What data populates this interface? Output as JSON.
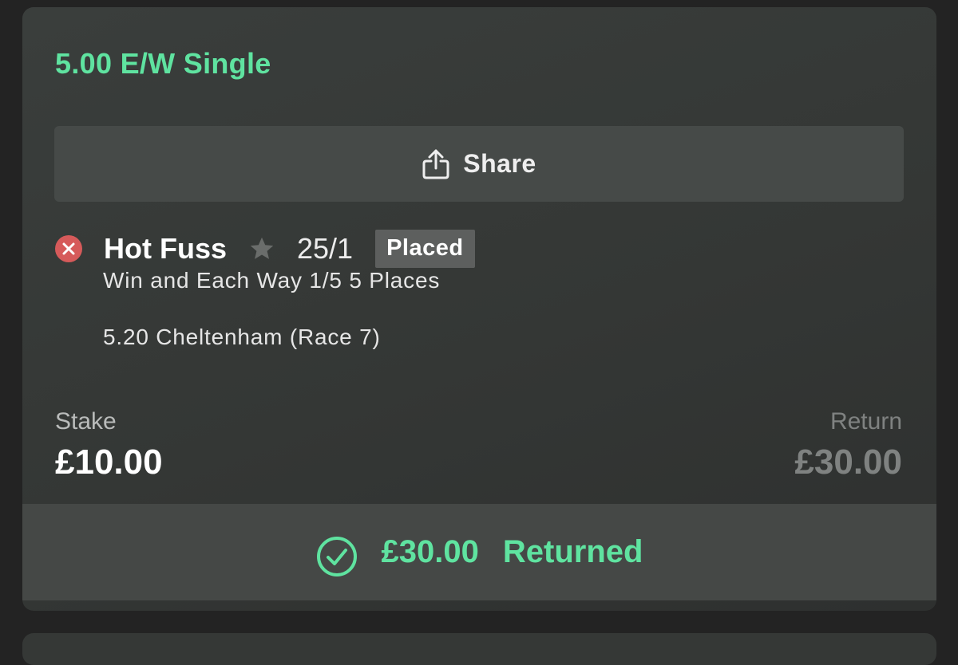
{
  "bet": {
    "title": "5.00 E/W Single",
    "share_label": "Share",
    "selection": {
      "name": "Hot Fuss",
      "odds": "25/1",
      "status_badge": "Placed",
      "market": "Win and Each Way 1/5 5 Places",
      "event": "5.20 Cheltenham (Race 7)",
      "result_icon": "x-circle-icon",
      "favourite_icon": "star-icon"
    },
    "stake_label": "Stake",
    "stake_value": "£10.00",
    "return_label": "Return",
    "return_value": "£30.00",
    "returned_amount": "£30.00",
    "returned_text": "Returned",
    "returned_icon": "check-circle-icon"
  },
  "colors": {
    "accent_green": "#5fe3a0",
    "lose_red": "#d65a5a",
    "card_bg": "#373a38",
    "page_bg": "#232323",
    "muted_text": "#7f8281"
  }
}
